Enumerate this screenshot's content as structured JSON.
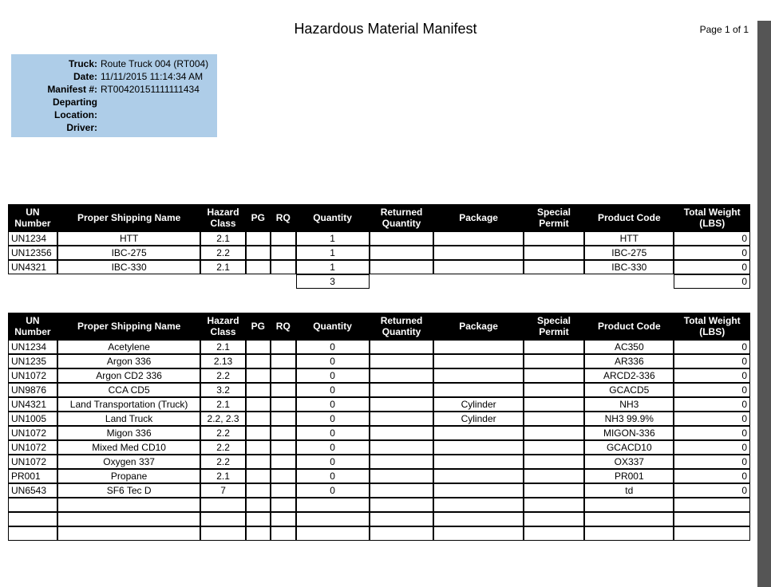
{
  "page_label": "Page 1 of 1",
  "title": "Hazardous Material Manifest",
  "info": {
    "truck_label": "Truck:",
    "truck_value": "Route Truck 004 (RT004)",
    "date_label": "Date:",
    "date_value": "11/11/2015 11:14:34 AM",
    "manifest_label": "Manifest #:",
    "manifest_value": "RT00420151111111434",
    "departing_label": "Departing Location:",
    "departing_value": "",
    "driver_label": "Driver:",
    "driver_value": ""
  },
  "headers": {
    "un": "UN Number",
    "name": "Proper Shipping Name",
    "hazard": "Hazard Class",
    "pg": "PG",
    "rq": "RQ",
    "qty": "Quantity",
    "ret": "Returned Quantity",
    "pkg": "Package",
    "sp": "Special Permit",
    "pc": "Product Code",
    "wt": "Total Weight (LBS)"
  },
  "table1": {
    "rows": [
      {
        "un": "UN1234",
        "name": "HTT",
        "hz": "2.1",
        "pg": "",
        "rq": "",
        "qty": "1",
        "ret": "",
        "pkg": "",
        "sp": "",
        "pc": "HTT",
        "wt": "0"
      },
      {
        "un": "UN12356",
        "name": "IBC-275",
        "hz": "2.2",
        "pg": "",
        "rq": "",
        "qty": "1",
        "ret": "",
        "pkg": "",
        "sp": "",
        "pc": "IBC-275",
        "wt": "0"
      },
      {
        "un": "UN4321",
        "name": "IBC-330",
        "hz": "2.1",
        "pg": "",
        "rq": "",
        "qty": "1",
        "ret": "",
        "pkg": "",
        "sp": "",
        "pc": "IBC-330",
        "wt": "0"
      }
    ],
    "totals": {
      "qty": "3",
      "wt": "0"
    }
  },
  "table2": {
    "rows": [
      {
        "un": "UN1234",
        "name": "Acetylene",
        "hz": "2.1",
        "pg": "",
        "rq": "",
        "qty": "0",
        "ret": "",
        "pkg": "",
        "sp": "",
        "pc": "AC350",
        "wt": "0"
      },
      {
        "un": "UN1235",
        "name": "Argon 336",
        "hz": "2.13",
        "pg": "",
        "rq": "",
        "qty": "0",
        "ret": "",
        "pkg": "",
        "sp": "",
        "pc": "AR336",
        "wt": "0"
      },
      {
        "un": "UN1072",
        "name": "Argon CD2 336",
        "hz": "2.2",
        "pg": "",
        "rq": "",
        "qty": "0",
        "ret": "",
        "pkg": "",
        "sp": "",
        "pc": "ARCD2-336",
        "wt": "0"
      },
      {
        "un": "UN9876",
        "name": "CCA CD5",
        "hz": "3.2",
        "pg": "",
        "rq": "",
        "qty": "0",
        "ret": "",
        "pkg": "",
        "sp": "",
        "pc": "GCACD5",
        "wt": "0"
      },
      {
        "un": "UN4321",
        "name": "Land Transportation (Truck)",
        "hz": "2.1",
        "pg": "",
        "rq": "",
        "qty": "0",
        "ret": "",
        "pkg": "Cylinder",
        "sp": "",
        "pc": "NH3",
        "wt": "0"
      },
      {
        "un": "UN1005",
        "name": "Land Truck",
        "hz": "2.2, 2.3",
        "pg": "",
        "rq": "",
        "qty": "0",
        "ret": "",
        "pkg": "Cylinder",
        "sp": "",
        "pc": "NH3 99.9%",
        "wt": "0"
      },
      {
        "un": "UN1072",
        "name": "Migon 336",
        "hz": "2.2",
        "pg": "",
        "rq": "",
        "qty": "0",
        "ret": "",
        "pkg": "",
        "sp": "",
        "pc": "MIGON-336",
        "wt": "0"
      },
      {
        "un": "UN1072",
        "name": "Mixed Med CD10",
        "hz": "2.2",
        "pg": "",
        "rq": "",
        "qty": "0",
        "ret": "",
        "pkg": "",
        "sp": "",
        "pc": "GCACD10",
        "wt": "0"
      },
      {
        "un": "UN1072",
        "name": "Oxygen 337",
        "hz": "2.2",
        "pg": "",
        "rq": "",
        "qty": "0",
        "ret": "",
        "pkg": "",
        "sp": "",
        "pc": "OX337",
        "wt": "0"
      },
      {
        "un": "PR001",
        "name": "Propane",
        "hz": "2.1",
        "pg": "",
        "rq": "",
        "qty": "0",
        "ret": "",
        "pkg": "",
        "sp": "",
        "pc": "PR001",
        "wt": "0"
      },
      {
        "un": "UN6543",
        "name": "SF6 Tec D",
        "hz": "7",
        "pg": "",
        "rq": "",
        "qty": "0",
        "ret": "",
        "pkg": "",
        "sp": "",
        "pc": "td",
        "wt": "0"
      },
      {
        "un": "",
        "name": "",
        "hz": "",
        "pg": "",
        "rq": "",
        "qty": "",
        "ret": "",
        "pkg": "",
        "sp": "",
        "pc": "",
        "wt": ""
      },
      {
        "un": "",
        "name": "",
        "hz": "",
        "pg": "",
        "rq": "",
        "qty": "",
        "ret": "",
        "pkg": "",
        "sp": "",
        "pc": "",
        "wt": ""
      },
      {
        "un": "",
        "name": "",
        "hz": "",
        "pg": "",
        "rq": "",
        "qty": "",
        "ret": "",
        "pkg": "",
        "sp": "",
        "pc": "",
        "wt": ""
      }
    ]
  }
}
